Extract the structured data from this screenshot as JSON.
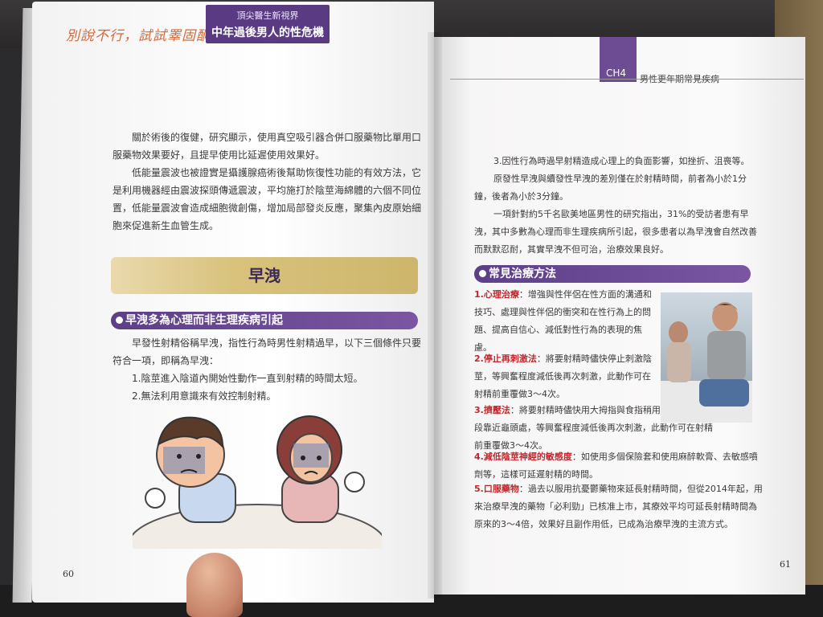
{
  "header_left": {
    "tagline": "別說不行，試試睪固酮！",
    "series_label": "頂尖醫生新視界",
    "book_title": "中年過後男人的性危機"
  },
  "header_right": {
    "chapter": "CH4",
    "chapter_title": "男性更年期常見疾病"
  },
  "left_page": {
    "intro_paragraphs": [
      "關於術後的復健，研究顯示，使用真空吸引器合併口服藥物比單用口服藥物效果要好，且提早使用比延遲使用效果好。",
      "低能量震波也被證實是攝護腺癌術後幫助恢復性功能的有效方法，它是利用機器經由震波探頭傳遞震波，平均施打於陰莖海綿體的六個不同位置，低能量震波會造成細胞微創傷，增加局部發炎反應，聚集內皮原始細胞來促進新生血管生成。"
    ],
    "section_title": "早洩",
    "subsection_title": "早洩多為心理而非生理疾病引起",
    "definition": "早發性射精俗稱早洩，指性行為時男性射精過早，以下三個條件只要符合一項，即稱為早洩：",
    "conditions": [
      "1.陰莖進入陰道內開始性動作一直到射精的時間太短。",
      "2.無法利用意識來有效控制射精。"
    ],
    "page_number": "60"
  },
  "right_page": {
    "paragraphs": [
      "3.因性行為時過早射精造成心理上的負面影響，如挫折、沮喪等。",
      "原發性早洩與續發性早洩的差別僅在於射精時間，前者為小於1分鐘，後者為小於3分鐘。",
      "一項針對約5千名歐美地區男性的研究指出，31%的受訪者患有早洩，其中多數為心理而非生理疾病所引起，很多患者以為早洩會自然改善而默默忍耐，其實早洩不但可治，治療效果良好。"
    ],
    "subsection_title": "常見治療方法",
    "treatments": [
      {
        "label": "1.心理治療",
        "text": "：增強與性伴侶在性方面的溝通和技巧、處理與性伴侶的衝突和在性行為上的問題、提高自信心、減低對性行為的表現的焦慮。"
      },
      {
        "label": "2.停止再刺激法",
        "text": "：將要射精時儘快停止刺激陰莖，等興奮程度減低後再次刺激，此動作可在射精前重覆做3～4次。"
      },
      {
        "label": "3.擠壓法",
        "text": "：將要射精時儘快用大拇指與食指稍用力擠壓陰莖前段靠近龜頭處，等興奮程度減低後再次刺激，此動作可在射精前重覆做3～4次。"
      },
      {
        "label": "4.減低陰莖神經的敏感度",
        "text": "：如使用多個保險套和使用麻醉軟膏、去敏感噴劑等，這樣可延遲射精的時間。"
      },
      {
        "label": "5.口服藥物",
        "text": "：過去以服用抗憂鬱藥物來延長射精時間，但從2014年起，用來治療早洩的藥物「必利勁」已核准上市，其療效平均可延長射精時間為原來的3～4倍，效果好且副作用低，已成為治療早洩的主流方式。"
      }
    ],
    "page_number": "61"
  },
  "colors": {
    "accent_purple": "#5d3f88",
    "banner_gold": "#d8c27d",
    "treatment_red": "#c1272d"
  }
}
